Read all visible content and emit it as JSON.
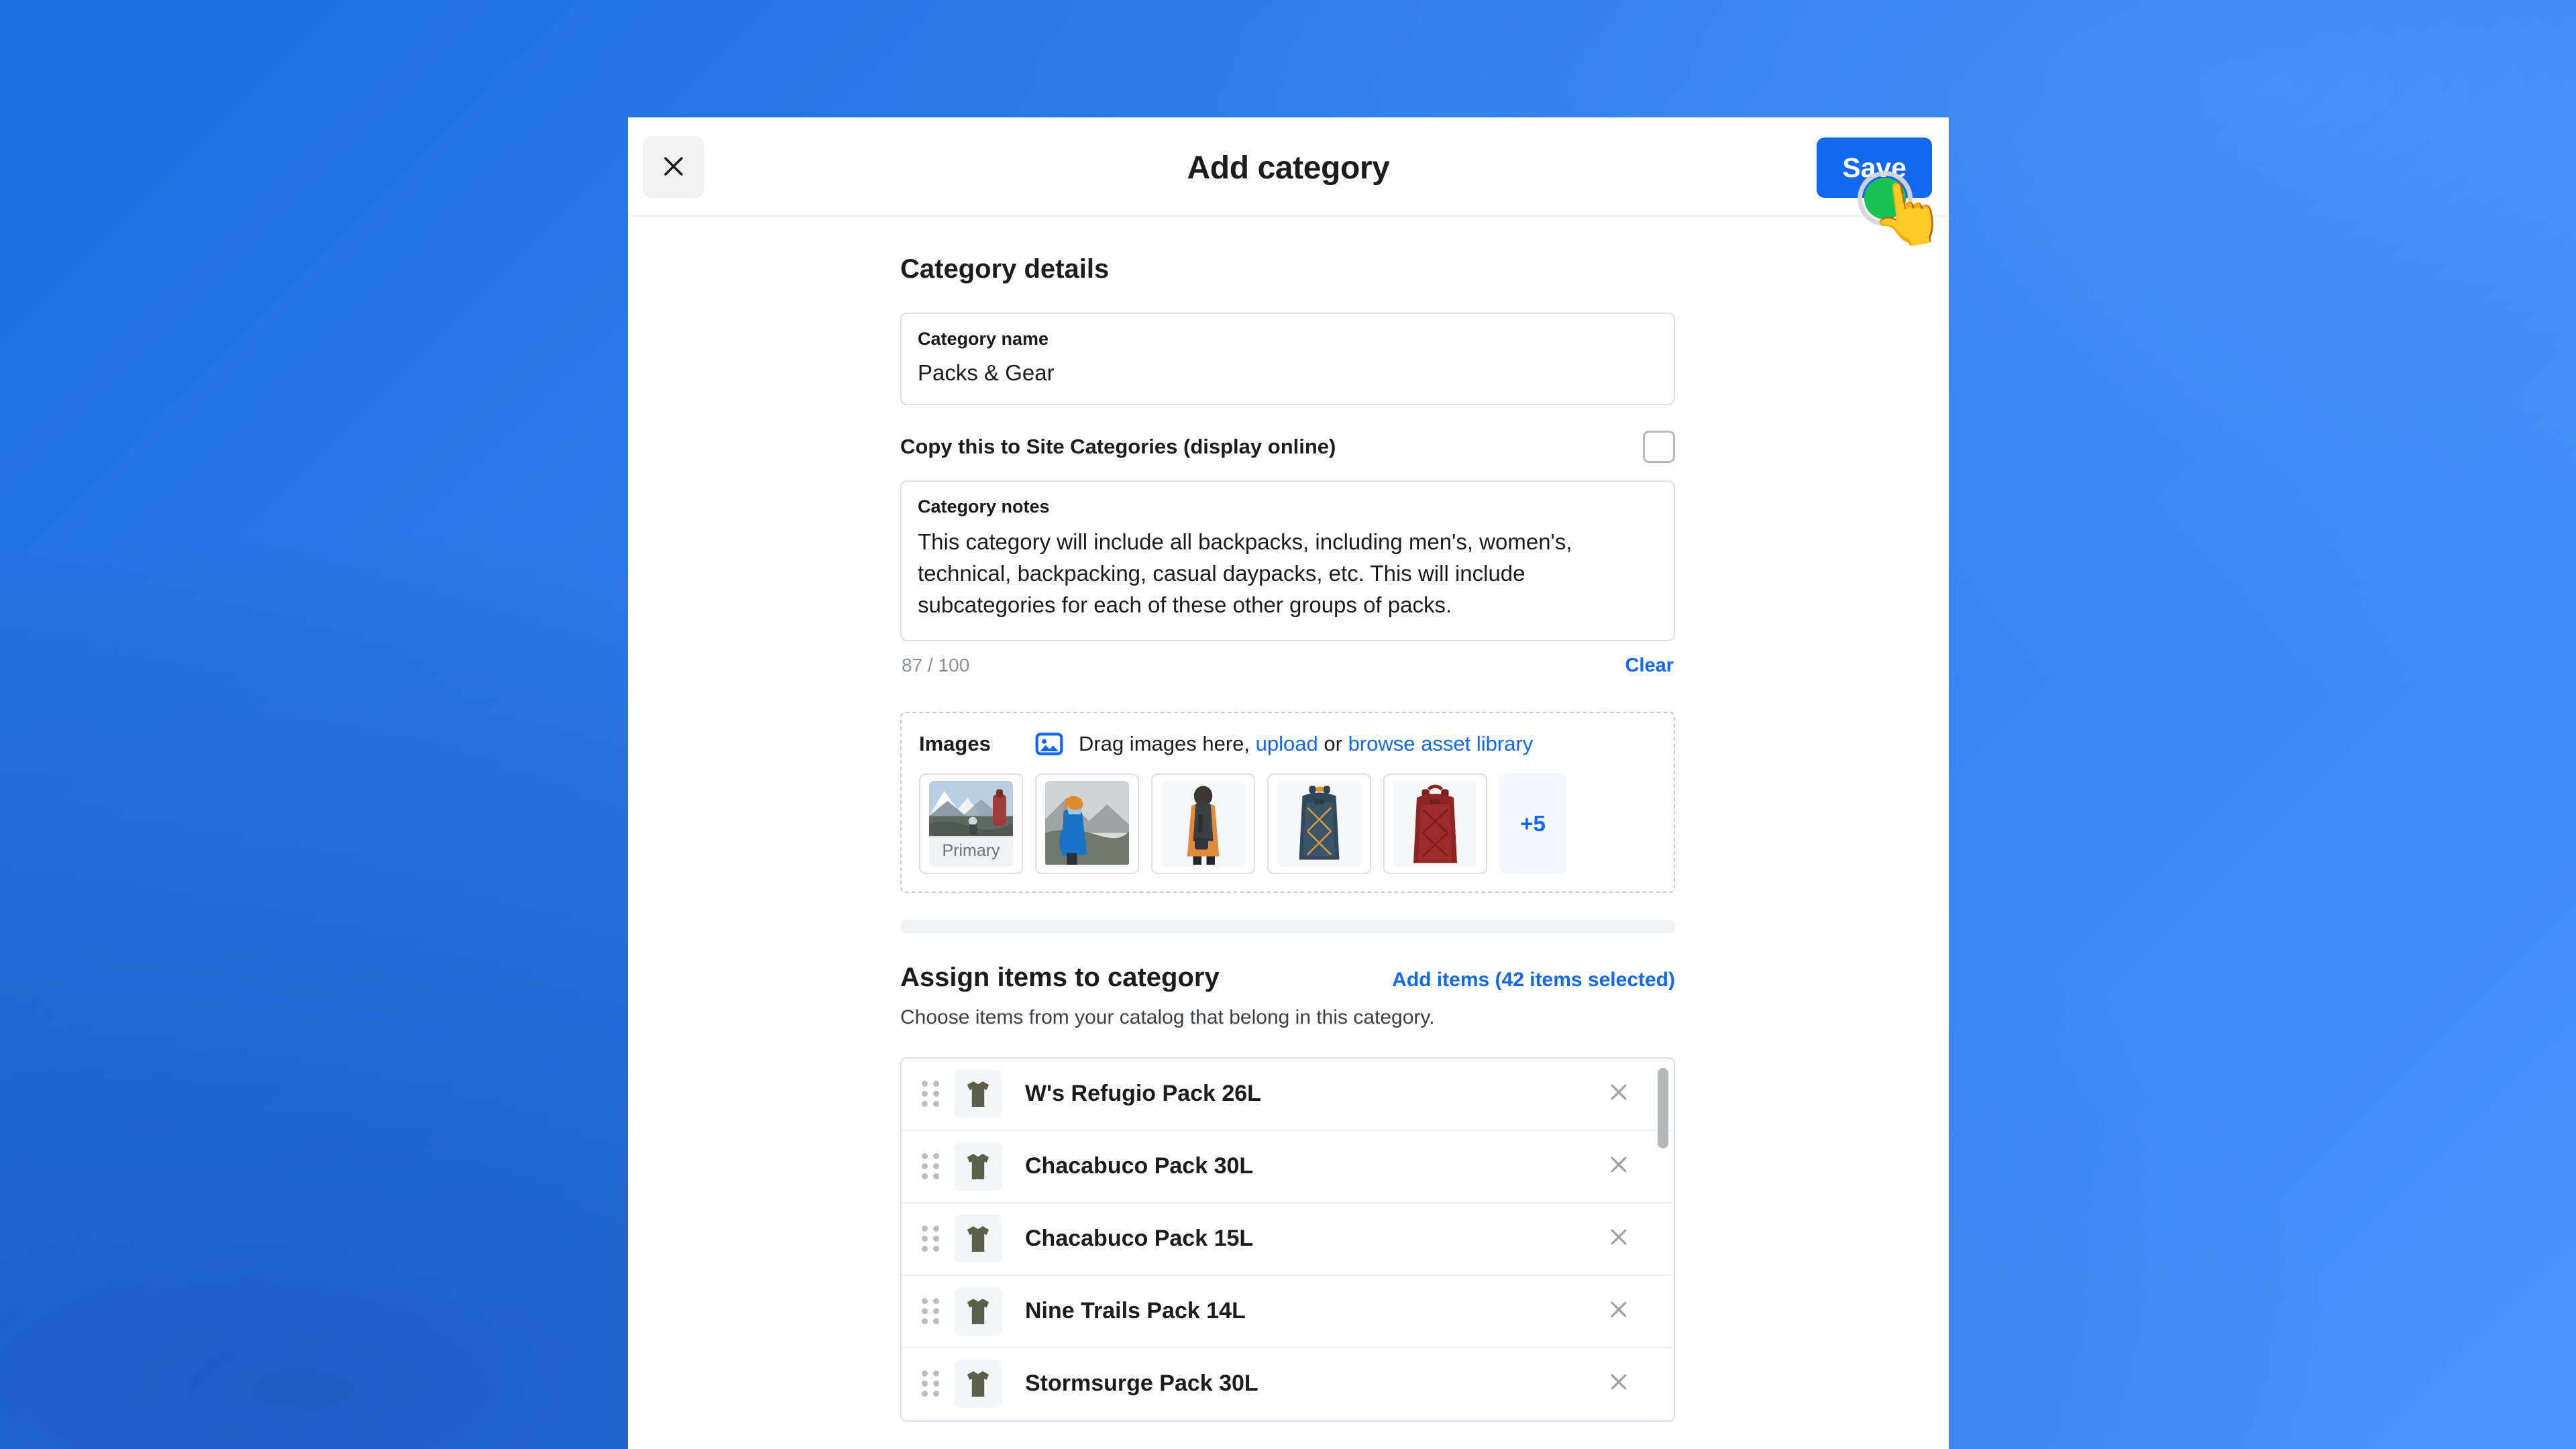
{
  "window": {
    "background_color": "#2f7ef0"
  },
  "modal": {
    "title": "Add category",
    "close_label": "Close",
    "save_label": "Save"
  },
  "cursor": {
    "icon": "pointing-hand-cursor",
    "click_indicator_color": "#17c252",
    "target": "Save"
  },
  "category_details": {
    "heading": "Category details",
    "name_field": {
      "label": "Category name",
      "value": "Packs & Gear"
    },
    "copy_checkbox": {
      "label": "Copy this to Site Categories (display online)",
      "checked": false
    },
    "notes_field": {
      "label": "Category notes",
      "value": "This category will include all backpacks, including men's, women's, technical, backpacking, casual daypacks, etc. This will include subcategories for each of these other groups of packs."
    },
    "counter": "87 / 100",
    "clear_label": "Clear"
  },
  "images": {
    "label": "Images",
    "icon": "image-icon",
    "hint_prefix": "Drag images here,",
    "upload_link": "upload",
    "hint_middle": "or",
    "browse_link": "browse asset library",
    "thumbnails": [
      {
        "alt": "mountain landscape with hiker",
        "badge": "Primary",
        "kind": "landscape"
      },
      {
        "alt": "person in blue jacket with orange helmet in snow",
        "badge": "",
        "kind": "climber"
      },
      {
        "alt": "person wearing black and orange pack",
        "badge": "",
        "kind": "person-pack"
      },
      {
        "alt": "teal blue backpack",
        "badge": "",
        "kind": "pack-teal"
      },
      {
        "alt": "dark red backpack",
        "badge": "",
        "kind": "pack-red"
      }
    ],
    "more_count": "+5"
  },
  "assign": {
    "heading": "Assign items to category",
    "add_items_link": "Add items (42 items selected)",
    "description": "Choose items from your catalog that belong in this category.",
    "items": [
      {
        "name": "W's Refugio Pack 26L",
        "icon": "tshirt-icon",
        "remove": "close-icon"
      },
      {
        "name": "Chacabuco Pack 30L",
        "icon": "tshirt-icon",
        "remove": "close-icon"
      },
      {
        "name": "Chacabuco Pack 15L",
        "icon": "tshirt-icon",
        "remove": "close-icon"
      },
      {
        "name": "Nine Trails Pack 14L",
        "icon": "tshirt-icon",
        "remove": "close-icon"
      },
      {
        "name": "Stormsurge Pack 30L",
        "icon": "tshirt-icon",
        "remove": "close-icon"
      }
    ]
  },
  "colors": {
    "accent_blue": "#1269ef",
    "text_primary": "#1c1c1c",
    "text_muted": "#8b9096",
    "border": "#dcdfe3",
    "item_icon": "#5d5f4a"
  }
}
